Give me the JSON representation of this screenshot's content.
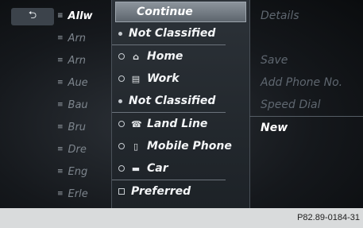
{
  "left": {
    "back_icon": "⮌",
    "items": [
      {
        "text": "Allw",
        "icon": "≡"
      },
      {
        "text": "Arn",
        "icon": "≡"
      },
      {
        "text": "Arn",
        "icon": "≡"
      },
      {
        "text": "Aue",
        "icon": "≡"
      },
      {
        "text": "Bau",
        "icon": "≡"
      },
      {
        "text": "Bru",
        "icon": "≡"
      },
      {
        "text": "Dre",
        "icon": "≡"
      },
      {
        "text": "Eng",
        "icon": "≡"
      },
      {
        "text": "Erle",
        "icon": "≡"
      }
    ]
  },
  "menu": {
    "continue": "Continue",
    "not_classified_1": "Not Classified",
    "home": "Home",
    "work": "Work",
    "not_classified_2": "Not Classified",
    "land_line": "Land Line",
    "mobile_phone": "Mobile Phone",
    "car": "Car",
    "preferred": "Preferred",
    "icons": {
      "home": "⌂",
      "work": "▤",
      "land_line": "☎",
      "mobile_phone": "▯",
      "car": "▬"
    }
  },
  "right": {
    "details": "Details",
    "faint_item": "",
    "save": "Save",
    "add_phone": "Add Phone No.",
    "speed_dial": "Speed Dial",
    "new": "New"
  },
  "footer": {
    "code": "P82.89-0184-31"
  }
}
